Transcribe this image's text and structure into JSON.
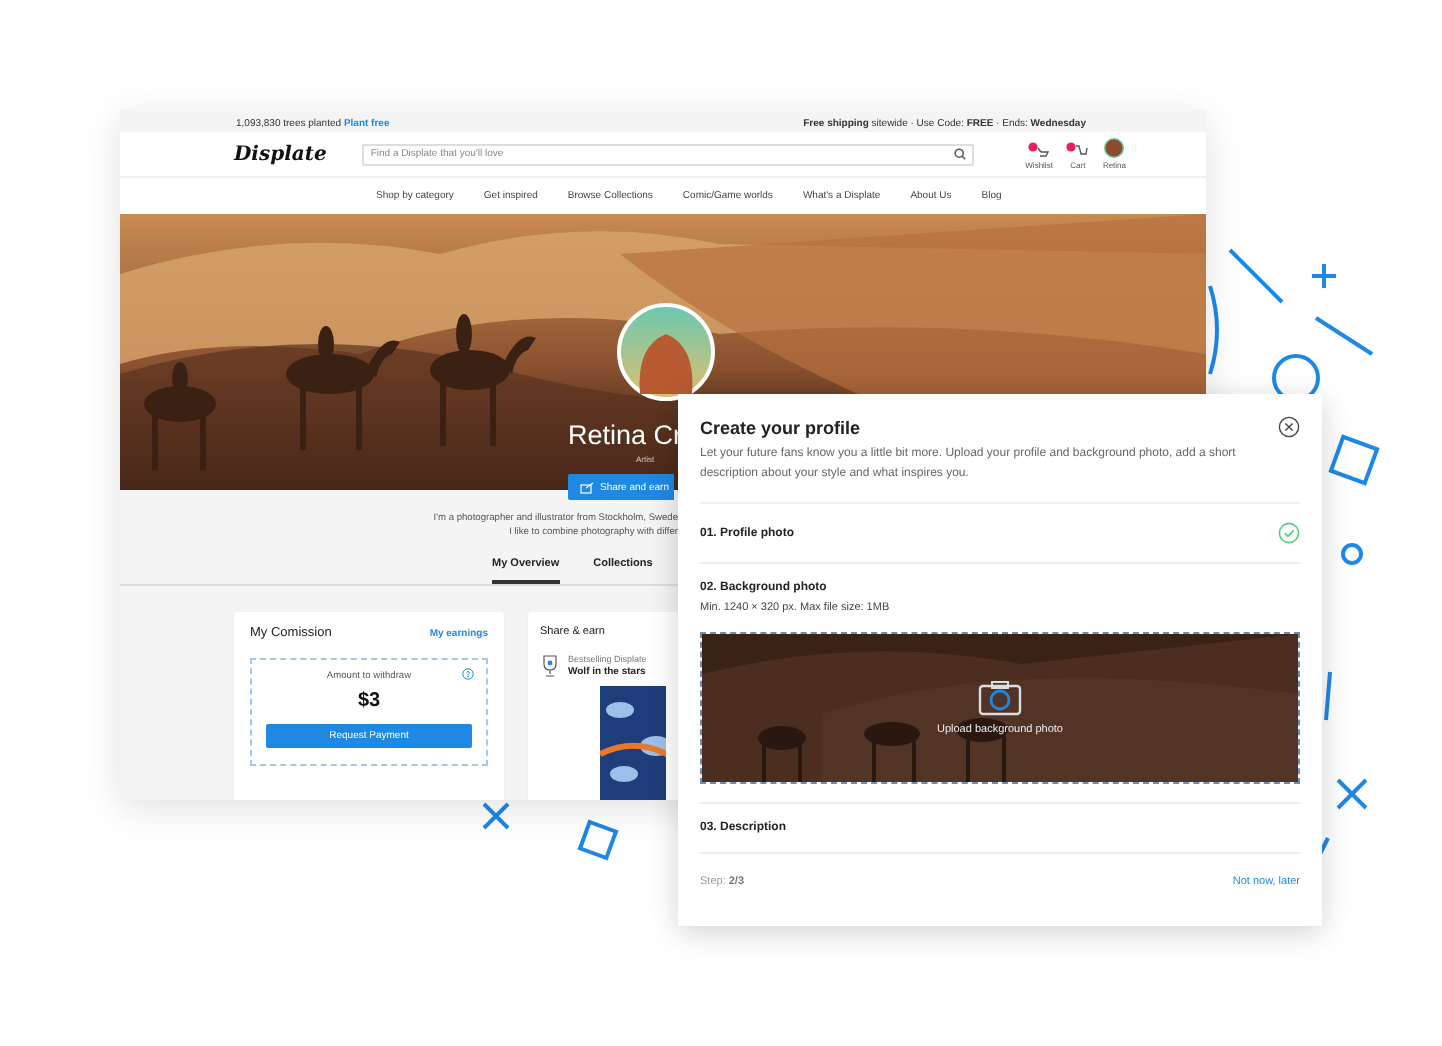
{
  "promo_bar": {
    "trees": "1,093,830 trees planted",
    "plant_link": "Plant free",
    "shipping": "**Free shipping** sitewide · Use Code: **FREE** · Ends: **Wednesday**"
  },
  "header": {
    "logo": "Displate",
    "search_placeholder": "Find a Displate that you'll love",
    "wishlist": "Wishlist",
    "cart": "Cart",
    "account": "Retina"
  },
  "nav": [
    "Shop by category",
    "Get inspired",
    "Browse Collections",
    "Comic/Game worlds",
    "What's a Displate",
    "About Us",
    "Blog"
  ],
  "profile": {
    "name": "Retina Cr",
    "role": "Artist",
    "share_button": "Share and earn",
    "bio": [
      "I'm a photographer and illustrator from Stockholm, Swede",
      "I like to combine photography with differ"
    ]
  },
  "tabs": [
    {
      "label": "My Overview",
      "selected": true
    },
    {
      "label": "Collections",
      "selected": false
    }
  ],
  "commission_card": {
    "title": "My Comission",
    "link": "My earnings",
    "amount_label": "Amount to withdraw",
    "amount": "$3",
    "button": "Request Payment"
  },
  "share_card": {
    "title": "Share & earn",
    "badge_label": "Bestselling Displate",
    "artwork_title": "Wolf in the stars"
  },
  "modal": {
    "title": "Create your profile",
    "description": "Let your future fans know you a little bit more. Upload your profile and background photo, add a short description about your style and what inspires you.",
    "steps": [
      {
        "label": "01. Profile photo",
        "done": true
      },
      {
        "label": "02. Background photo",
        "done": false,
        "hint": "Min. 1240 × 320 px. Max file size: 1MB",
        "upload_label": "Upload background photo"
      },
      {
        "label": "03. Description",
        "done": false
      }
    ],
    "step_text": "Step: **2/3**",
    "skip_link": "Not now, later"
  }
}
